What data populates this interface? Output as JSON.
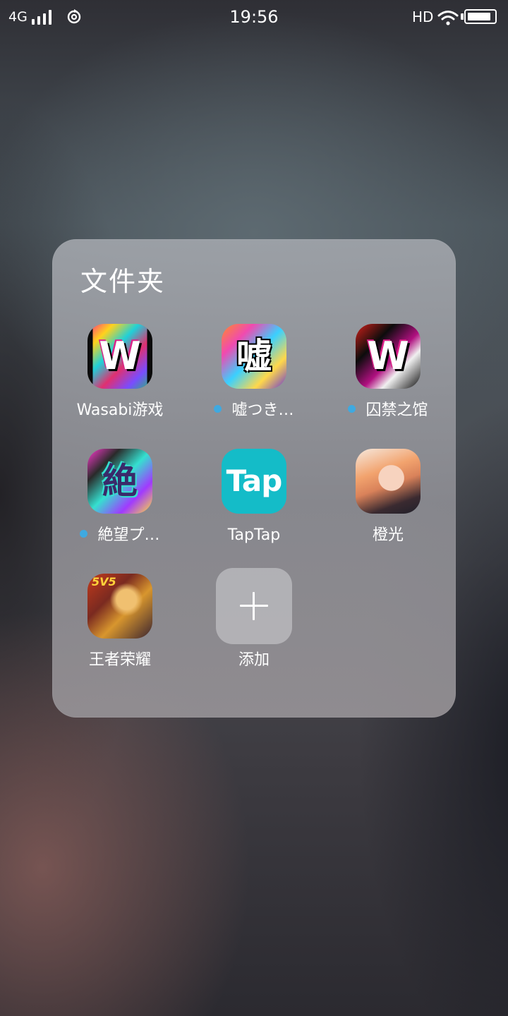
{
  "status_bar": {
    "network": "4G",
    "time": "19:56",
    "hd": "HD",
    "battery_level": 0.9
  },
  "folder": {
    "title": "文件夹",
    "apps": [
      {
        "label": "Wasabi游戏",
        "icon": "wasabi-game-icon",
        "glyph": "W",
        "new": false
      },
      {
        "label": "嘘つき…",
        "icon": "usotsuki-game-icon",
        "glyph": "嘘",
        "new": true
      },
      {
        "label": "囚禁之馆",
        "icon": "inkin-mansion-icon",
        "glyph": "W",
        "new": true
      },
      {
        "label": "絶望プ…",
        "icon": "zetsubou-game-icon",
        "glyph": "絶",
        "new": true
      },
      {
        "label": "TapTap",
        "icon": "taptap-icon",
        "glyph": "Tap",
        "new": false
      },
      {
        "label": "橙光",
        "icon": "chengguang-icon",
        "new": false
      },
      {
        "label": "王者荣耀",
        "icon": "honor-of-kings-icon",
        "glyph": "5V5",
        "new": false
      }
    ],
    "add_label": "添加"
  },
  "colors": {
    "new_dot": "#3fa9e0",
    "taptap_brand": "#14bcc8"
  }
}
